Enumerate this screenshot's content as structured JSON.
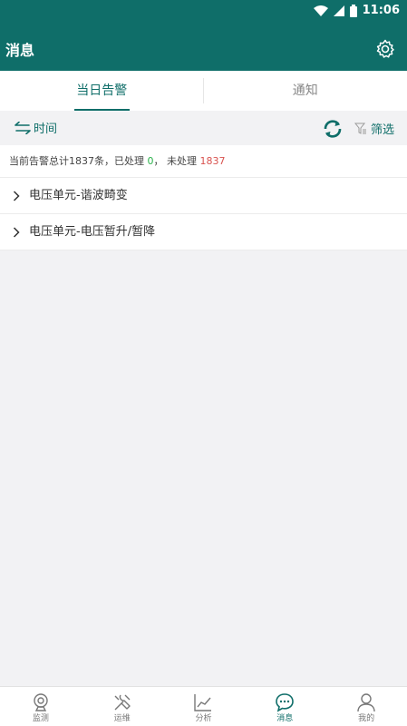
{
  "status_bar": {
    "time": "11:06"
  },
  "app_bar": {
    "title": "消息"
  },
  "tabs": [
    {
      "label": "当日告警",
      "active": true
    },
    {
      "label": "通知",
      "active": false
    }
  ],
  "filter_bar": {
    "time_label": "时间",
    "filter_label": "筛选"
  },
  "summary": {
    "prefix": "当前告警总计1837条，已处理",
    "processed": "0",
    "middle": "，  未处理",
    "unprocessed": "1837"
  },
  "list": [
    {
      "label": "电压单元-谐波畸变"
    },
    {
      "label": "电压单元-电压暂升/暂降"
    }
  ],
  "bottom_nav": [
    {
      "label": "监测",
      "icon": "camera-icon",
      "active": false
    },
    {
      "label": "运维",
      "icon": "tools-icon",
      "active": false
    },
    {
      "label": "分析",
      "icon": "chart-icon",
      "active": false
    },
    {
      "label": "消息",
      "icon": "message-icon",
      "active": true
    },
    {
      "label": "我的",
      "icon": "user-icon",
      "active": false
    }
  ],
  "colors": {
    "primary": "#0f6e69",
    "processed": "#2bb24c",
    "unprocessed": "#d9534f"
  }
}
